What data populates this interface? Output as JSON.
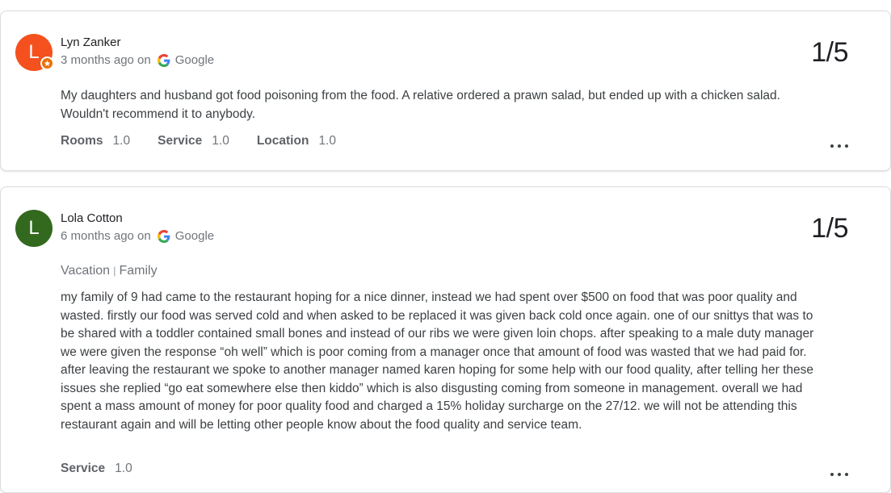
{
  "reviews": [
    {
      "initial": "L",
      "avatar_color": "#f4511e",
      "local_guide_badge": true,
      "name": "Lyn Zanker",
      "date": "3 months ago on",
      "source": "Google",
      "score": "1/5",
      "text": "My daughters and husband got food poisoning from the food. A relative ordered a prawn salad, but ended up with a chicken salad. Wouldn't recommend it to anybody.",
      "ratings": [
        {
          "label": "Rooms",
          "value": "1.0"
        },
        {
          "label": "Service",
          "value": "1.0"
        },
        {
          "label": "Location",
          "value": "1.0"
        }
      ]
    },
    {
      "initial": "L",
      "avatar_color": "#33691e",
      "local_guide_badge": false,
      "name": "Lola Cotton",
      "date": "6 months ago on",
      "source": "Google",
      "score": "1/5",
      "trip_type": "Vacation",
      "trip_separator": "|",
      "trip_group": "Family",
      "text": "my family of 9 had came to the restaurant hoping for a nice dinner, instead we had spent over $500 on food that was poor quality and wasted. firstly our food was served cold and when asked to be replaced it was given back cold once again. one of our snittys that was to be shared with a toddler contained small bones and instead of our ribs we were given loin chops. after speaking to a male duty manager we were given the response “oh well” which is poor coming from a manager once that amount of food was wasted that we had paid for. after leaving the restaurant we spoke to another manager named karen hoping for some help with our food quality, after telling her these issues she replied “go eat somewhere else then kiddo” which is also disgusting coming from someone in management. overall we had spent a mass amount of money for poor quality food and charged a 15% holiday surcharge on the 27/12. we will not be attending this restaurant again and will be letting other people know about the food quality and service team.",
      "ratings": [
        {
          "label": "Service",
          "value": "1.0"
        }
      ]
    }
  ]
}
